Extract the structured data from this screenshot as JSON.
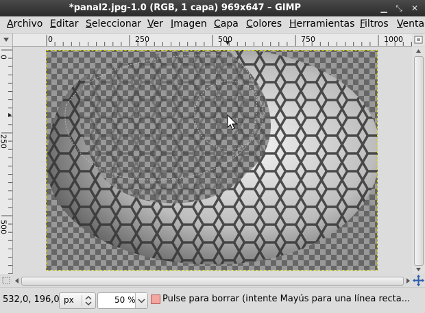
{
  "window": {
    "title": "*panal2.jpg-1.0 (RGB, 1 capa) 969x647 – GIMP",
    "minimize_glyph": "▁",
    "maximize_glyph": "⤡",
    "close_glyph": "✕"
  },
  "menu": {
    "items": [
      {
        "label": "Archivo",
        "mnemonic": "A",
        "rest": "rchivo"
      },
      {
        "label": "Editar",
        "mnemonic": "E",
        "rest": "ditar"
      },
      {
        "label": "Seleccionar",
        "mnemonic": "S",
        "rest": "eleccionar"
      },
      {
        "label": "Ver",
        "mnemonic": "V",
        "rest": "er"
      },
      {
        "label": "Imagen",
        "mnemonic": "I",
        "rest": "magen"
      },
      {
        "label": "Capa",
        "mnemonic": "C",
        "rest": "apa"
      },
      {
        "label": "Colores",
        "mnemonic": "C",
        "rest": "olores"
      },
      {
        "label": "Herramientas",
        "mnemonic": "H",
        "rest": "erramientas"
      },
      {
        "label": "Filtros",
        "mnemonic": "F",
        "rest": "iltros"
      },
      {
        "label": "Ventanas",
        "mnemonic": "V",
        "rest": "entanas"
      }
    ]
  },
  "rulers": {
    "horizontal_labels": [
      "0",
      "250",
      "500",
      "750",
      "1000"
    ],
    "vertical_labels": [
      "0",
      "250",
      "500"
    ]
  },
  "status": {
    "coordinates": "532,0, 196,0",
    "unit": "px",
    "zoom": "50 %",
    "message": "Pulse para borrar (intente Mayús para una línea recta..."
  },
  "colors": {
    "selection_border": "#e6e600",
    "checker_dark": "#666666",
    "checker_light": "#999999",
    "message_icon": "#f4a6a0"
  }
}
